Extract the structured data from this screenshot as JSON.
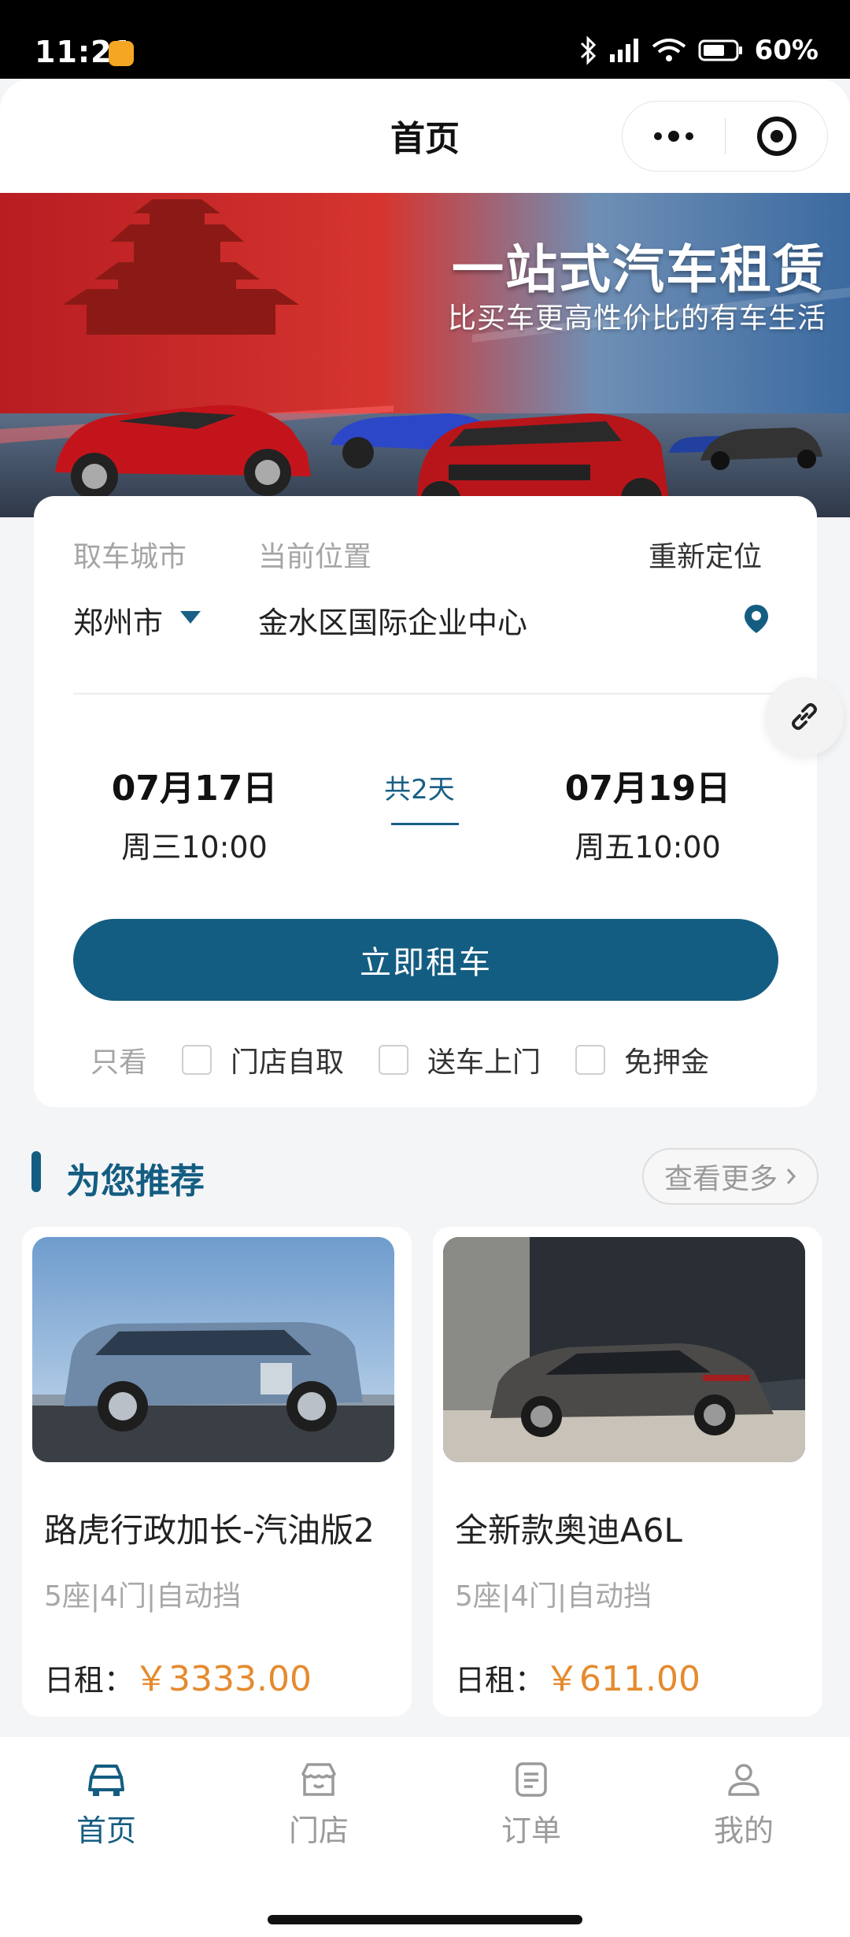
{
  "status_bar": {
    "time": "11:21",
    "battery": "60%"
  },
  "header": {
    "title": "首页"
  },
  "banner": {
    "title": "一站式汽车租赁",
    "subtitle": "比买车更高性价比的有车生活"
  },
  "booking": {
    "city_label": "取车城市",
    "location_label": "当前位置",
    "relocate_label": "重新定位",
    "city_value": "郑州市",
    "address_value": "金水区国际企业中心",
    "pickup": {
      "date": "07月17日",
      "time": "周三10:00"
    },
    "duration": "共2天",
    "return": {
      "date": "07月19日",
      "time": "周五10:00"
    },
    "rent_button": "立即租车",
    "filter_label": "只看",
    "filters": [
      "门店自取",
      "送车上门",
      "免押金"
    ]
  },
  "recommend": {
    "title": "为您推荐",
    "more": "查看更多",
    "cars": [
      {
        "name": "路虎行政加长-汽油版2",
        "specs": "5座|4门|自动挡",
        "price_label": "日租：",
        "price": "￥3333.00"
      },
      {
        "name": "全新款奥迪A6L",
        "specs": "5座|4门|自动挡",
        "price_label": "日租：",
        "price": "￥611.00"
      }
    ]
  },
  "tabs": [
    {
      "label": "首页",
      "icon": "car-icon",
      "active": true
    },
    {
      "label": "门店",
      "icon": "store-icon",
      "active": false
    },
    {
      "label": "订单",
      "icon": "order-icon",
      "active": false
    },
    {
      "label": "我的",
      "icon": "user-icon",
      "active": false
    }
  ],
  "colors": {
    "primary": "#145d82",
    "price": "#e58a2e",
    "muted": "#a5a5a5"
  }
}
